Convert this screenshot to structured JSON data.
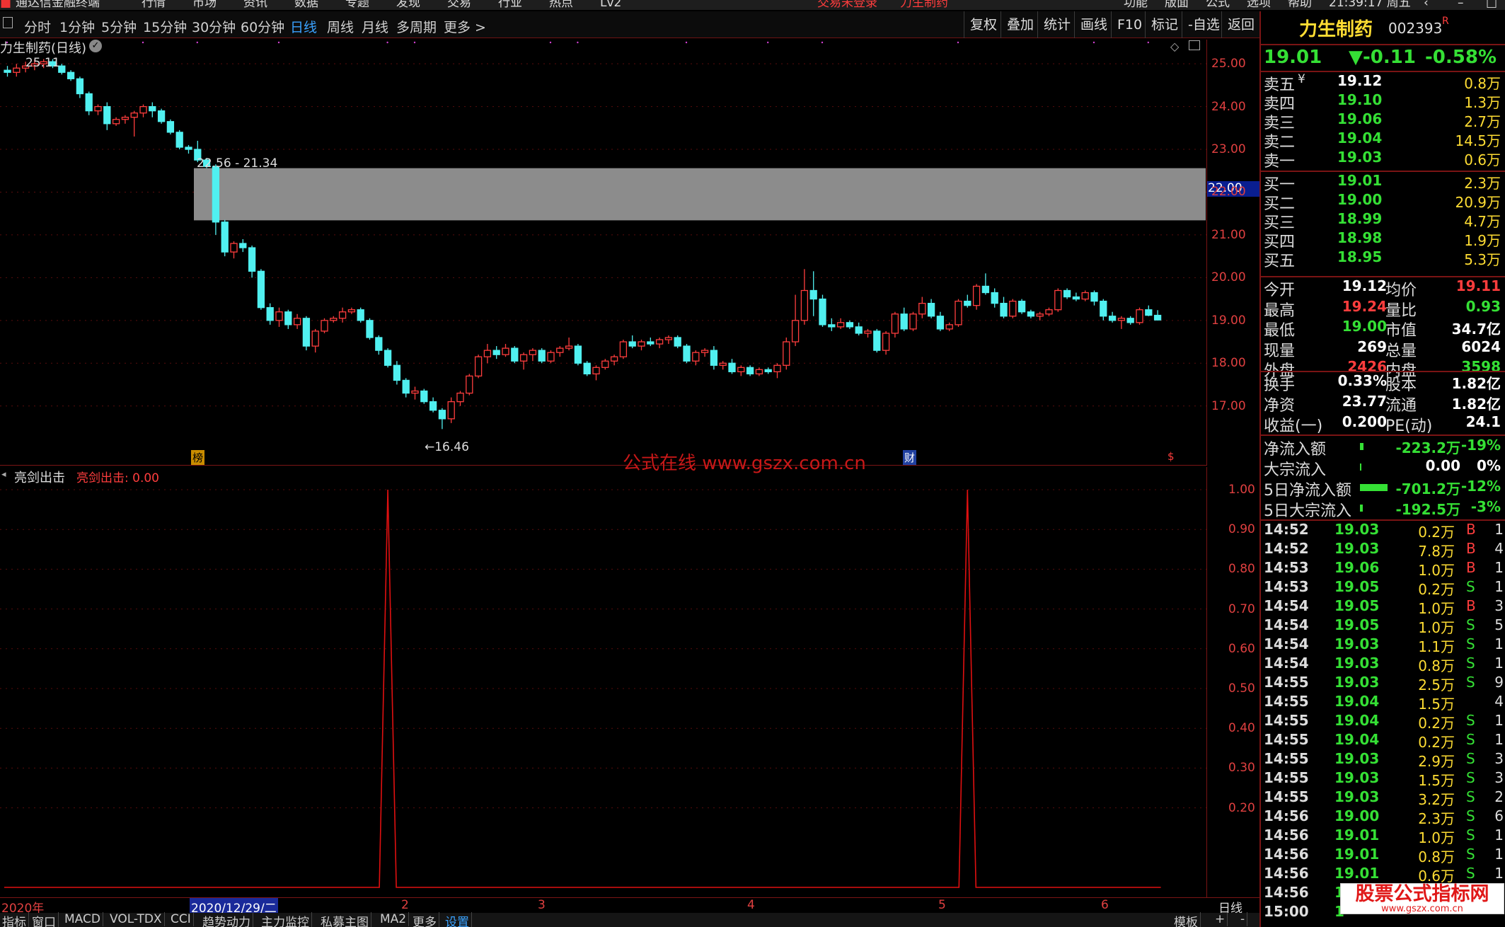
{
  "menubar": {
    "items": [
      "通达信金融终端",
      "行情",
      "市场",
      "资讯",
      "数据",
      "专题",
      "发现",
      "交易",
      "行业",
      "热点",
      "Lv2",
      "交易未登录",
      "力生制药",
      "功能",
      "版面",
      "公式",
      "选项",
      "帮助",
      "21:39:17 周五"
    ]
  },
  "toolbar": {
    "periods": [
      "分时",
      "1分钟",
      "5分钟",
      "15分钟",
      "30分钟",
      "60分钟",
      "日线",
      "周线",
      "月线",
      "多周期",
      "更多 >"
    ],
    "active_period": "日线",
    "right_buttons": [
      "复权",
      "叠加",
      "统计",
      "画线",
      "F10",
      "标记",
      "-自选",
      "返回"
    ]
  },
  "main_chart": {
    "title": "力生制药(日线)",
    "y_ticks": [
      "25.00",
      "24.00",
      "23.00",
      "22.00",
      "21.00",
      "20.00",
      "19.00",
      "18.00",
      "17.00"
    ],
    "price_marker": "22.00",
    "high_label": "25.11",
    "low_label": "←16.46",
    "range_label": "22.56 - 21.34",
    "box_top": 22.56,
    "box_bottom": 21.34,
    "event_markers": [
      "榜",
      "财",
      "$"
    ],
    "watermark": "公式在线  www.gszx.com.cn"
  },
  "sub_chart": {
    "title": "亮剑出击",
    "value_label": "亮剑出击: 0.00",
    "y_ticks": [
      "1.00",
      "0.90",
      "0.80",
      "0.70",
      "0.60",
      "0.50",
      "0.40",
      "0.30",
      "0.20"
    ],
    "signal_candle_indices": [
      42,
      106
    ]
  },
  "date_axis": {
    "labels": [
      "2020年",
      "2020/12/29/二",
      "2",
      "3",
      "4",
      "5",
      "6"
    ],
    "period_label": "日线"
  },
  "bottom_tabs": [
    "指标",
    "窗口",
    "MACD",
    "VOL-TDX",
    "CCI",
    "趋势动力",
    "主力监控",
    "私募主图",
    "MA2",
    "更多",
    "设置",
    "模板",
    "+",
    "-"
  ],
  "chart_data": {
    "type": "candlestick",
    "ylim": [
      16.3,
      25.4
    ],
    "candles": [
      [
        24.85,
        24.95,
        24.7,
        24.8
      ],
      [
        24.8,
        25.0,
        24.7,
        24.9
      ],
      [
        24.9,
        25.05,
        24.8,
        24.95
      ],
      [
        24.95,
        25.1,
        24.85,
        25.0
      ],
      [
        25.0,
        25.11,
        24.9,
        25.05
      ],
      [
        25.05,
        25.11,
        24.9,
        24.95
      ],
      [
        24.95,
        25.0,
        24.75,
        24.8
      ],
      [
        24.8,
        24.85,
        24.6,
        24.65
      ],
      [
        24.65,
        24.7,
        24.2,
        24.3
      ],
      [
        24.3,
        24.35,
        23.8,
        23.9
      ],
      [
        23.9,
        24.05,
        23.8,
        24.0
      ],
      [
        24.0,
        24.1,
        23.45,
        23.6
      ],
      [
        23.6,
        23.75,
        23.55,
        23.7
      ],
      [
        23.7,
        23.8,
        23.6,
        23.75
      ],
      [
        23.75,
        23.9,
        23.3,
        23.85
      ],
      [
        23.85,
        24.05,
        23.75,
        24.0
      ],
      [
        24.0,
        24.1,
        23.75,
        23.9
      ],
      [
        23.9,
        23.95,
        23.6,
        23.65
      ],
      [
        23.65,
        23.7,
        23.35,
        23.4
      ],
      [
        23.4,
        23.45,
        23.0,
        23.05
      ],
      [
        23.05,
        23.1,
        22.9,
        23.0
      ],
      [
        23.0,
        23.2,
        22.7,
        22.75
      ],
      [
        22.75,
        22.8,
        22.56,
        22.6
      ],
      [
        22.6,
        22.65,
        21.0,
        21.3
      ],
      [
        21.3,
        21.35,
        20.5,
        20.6
      ],
      [
        20.6,
        20.85,
        20.45,
        20.8
      ],
      [
        20.8,
        20.9,
        20.6,
        20.7
      ],
      [
        20.7,
        20.75,
        20.0,
        20.15
      ],
      [
        20.15,
        20.2,
        19.25,
        19.3
      ],
      [
        19.3,
        19.4,
        18.9,
        19.0
      ],
      [
        19.0,
        19.3,
        18.85,
        19.2
      ],
      [
        19.2,
        19.25,
        18.8,
        18.9
      ],
      [
        18.9,
        19.15,
        18.8,
        19.05
      ],
      [
        19.05,
        19.1,
        18.3,
        18.4
      ],
      [
        18.4,
        18.8,
        18.25,
        18.75
      ],
      [
        18.75,
        19.05,
        18.7,
        19.0
      ],
      [
        19.0,
        19.1,
        18.95,
        19.05
      ],
      [
        19.05,
        19.3,
        18.95,
        19.2
      ],
      [
        19.2,
        19.3,
        19.15,
        19.25
      ],
      [
        19.25,
        19.3,
        18.95,
        19.0
      ],
      [
        19.0,
        19.05,
        18.55,
        18.6
      ],
      [
        18.6,
        18.65,
        18.2,
        18.3
      ],
      [
        18.3,
        18.35,
        17.9,
        17.95
      ],
      [
        17.95,
        18.05,
        17.5,
        17.6
      ],
      [
        17.6,
        17.65,
        17.2,
        17.3
      ],
      [
        17.3,
        17.45,
        17.15,
        17.35
      ],
      [
        17.35,
        17.4,
        17.05,
        17.1
      ],
      [
        17.1,
        17.2,
        16.85,
        16.9
      ],
      [
        16.9,
        16.95,
        16.46,
        16.7
      ],
      [
        16.7,
        17.2,
        16.6,
        17.1
      ],
      [
        17.1,
        17.35,
        17.0,
        17.3
      ],
      [
        17.3,
        17.75,
        17.25,
        17.7
      ],
      [
        17.7,
        18.2,
        17.65,
        18.15
      ],
      [
        18.15,
        18.45,
        18.0,
        18.3
      ],
      [
        18.3,
        18.4,
        18.1,
        18.2
      ],
      [
        18.2,
        18.45,
        18.15,
        18.35
      ],
      [
        18.35,
        18.4,
        18.0,
        18.05
      ],
      [
        18.05,
        18.25,
        17.85,
        18.2
      ],
      [
        18.2,
        18.35,
        18.05,
        18.3
      ],
      [
        18.3,
        18.35,
        18.0,
        18.05
      ],
      [
        18.05,
        18.3,
        18.0,
        18.25
      ],
      [
        18.25,
        18.4,
        18.15,
        18.35
      ],
      [
        18.35,
        18.6,
        18.3,
        18.4
      ],
      [
        18.4,
        18.45,
        17.95,
        18.0
      ],
      [
        18.0,
        18.05,
        17.7,
        17.75
      ],
      [
        17.75,
        17.95,
        17.6,
        17.9
      ],
      [
        17.9,
        18.1,
        17.85,
        18.05
      ],
      [
        18.05,
        18.2,
        17.95,
        18.15
      ],
      [
        18.15,
        18.55,
        18.1,
        18.5
      ],
      [
        18.5,
        18.65,
        18.35,
        18.4
      ],
      [
        18.4,
        18.55,
        18.3,
        18.5
      ],
      [
        18.5,
        18.6,
        18.4,
        18.45
      ],
      [
        18.45,
        18.6,
        18.35,
        18.55
      ],
      [
        18.55,
        18.65,
        18.45,
        18.6
      ],
      [
        18.6,
        18.65,
        18.35,
        18.4
      ],
      [
        18.4,
        18.45,
        18.0,
        18.05
      ],
      [
        18.05,
        18.3,
        17.95,
        18.25
      ],
      [
        18.25,
        18.35,
        18.15,
        18.3
      ],
      [
        18.3,
        18.4,
        17.85,
        17.95
      ],
      [
        17.95,
        18.05,
        17.85,
        18.0
      ],
      [
        18.0,
        18.1,
        17.75,
        17.8
      ],
      [
        17.8,
        17.95,
        17.7,
        17.9
      ],
      [
        17.9,
        17.95,
        17.7,
        17.75
      ],
      [
        17.75,
        17.9,
        17.7,
        17.85
      ],
      [
        17.85,
        17.9,
        17.75,
        17.8
      ],
      [
        17.8,
        18.0,
        17.65,
        17.95
      ],
      [
        17.95,
        18.6,
        17.85,
        18.5
      ],
      [
        18.5,
        19.6,
        18.4,
        19.0
      ],
      [
        19.0,
        20.2,
        18.9,
        19.7
      ],
      [
        19.7,
        20.15,
        19.1,
        19.5
      ],
      [
        19.5,
        19.6,
        18.85,
        18.9
      ],
      [
        18.9,
        19.05,
        18.75,
        18.85
      ],
      [
        18.85,
        19.05,
        18.8,
        18.95
      ],
      [
        18.95,
        19.0,
        18.8,
        18.85
      ],
      [
        18.85,
        18.95,
        18.65,
        18.7
      ],
      [
        18.7,
        18.8,
        18.6,
        18.75
      ],
      [
        18.75,
        18.8,
        18.25,
        18.3
      ],
      [
        18.3,
        18.75,
        18.2,
        18.7
      ],
      [
        18.7,
        19.2,
        18.6,
        19.15
      ],
      [
        19.15,
        19.3,
        18.75,
        18.8
      ],
      [
        18.8,
        19.2,
        18.75,
        19.15
      ],
      [
        19.15,
        19.55,
        19.05,
        19.4
      ],
      [
        19.4,
        19.5,
        19.05,
        19.1
      ],
      [
        19.1,
        19.2,
        18.75,
        18.8
      ],
      [
        18.8,
        18.95,
        18.75,
        18.9
      ],
      [
        18.9,
        19.5,
        18.85,
        19.45
      ],
      [
        19.45,
        19.6,
        19.3,
        19.35
      ],
      [
        19.35,
        19.85,
        19.25,
        19.8
      ],
      [
        19.8,
        20.1,
        19.6,
        19.65
      ],
      [
        19.65,
        19.75,
        19.3,
        19.4
      ],
      [
        19.4,
        19.55,
        19.05,
        19.1
      ],
      [
        19.1,
        19.5,
        19.05,
        19.45
      ],
      [
        19.45,
        19.5,
        19.15,
        19.2
      ],
      [
        19.2,
        19.25,
        19.05,
        19.1
      ],
      [
        19.1,
        19.2,
        19.0,
        19.15
      ],
      [
        19.15,
        19.3,
        19.1,
        19.25
      ],
      [
        19.25,
        19.75,
        19.2,
        19.7
      ],
      [
        19.7,
        19.75,
        19.5,
        19.55
      ],
      [
        19.55,
        19.65,
        19.45,
        19.5
      ],
      [
        19.5,
        19.7,
        19.45,
        19.65
      ],
      [
        19.65,
        19.7,
        19.35,
        19.45
      ],
      [
        19.45,
        19.5,
        19.0,
        19.1
      ],
      [
        19.1,
        19.2,
        18.95,
        19.0
      ],
      [
        19.0,
        19.1,
        18.8,
        19.05
      ],
      [
        19.05,
        19.1,
        18.9,
        18.95
      ],
      [
        18.95,
        19.3,
        18.9,
        19.25
      ],
      [
        19.25,
        19.35,
        19.1,
        19.12
      ],
      [
        19.12,
        19.24,
        19.0,
        19.01
      ]
    ]
  },
  "quote_panel": {
    "stock_name": "力生制药",
    "stock_code": "002393",
    "stock_tag": "R",
    "price": "19.01",
    "change": "▼-0.11",
    "change_pct": "-0.58%",
    "asks": [
      {
        "label": "卖五",
        "sym": "¥",
        "price": "19.12",
        "vol": "0.8万"
      },
      {
        "label": "卖四",
        "sym": "",
        "price": "19.10",
        "vol": "1.3万"
      },
      {
        "label": "卖三",
        "sym": "",
        "price": "19.06",
        "vol": "2.7万"
      },
      {
        "label": "卖二",
        "sym": "",
        "price": "19.04",
        "vol": "14.5万"
      },
      {
        "label": "卖一",
        "sym": "",
        "price": "19.03",
        "vol": "0.6万"
      }
    ],
    "bids": [
      {
        "label": "买一",
        "price": "19.01",
        "vol": "2.3万"
      },
      {
        "label": "买二",
        "price": "19.00",
        "vol": "20.9万"
      },
      {
        "label": "买三",
        "price": "18.99",
        "vol": "4.7万"
      },
      {
        "label": "买四",
        "price": "18.98",
        "vol": "1.9万"
      },
      {
        "label": "买五",
        "price": "18.95",
        "vol": "5.3万"
      }
    ],
    "stats": [
      {
        "l1": "今开",
        "v1": "19.12",
        "c1": "white",
        "l2": "均价",
        "v2": "19.11",
        "c2": "red"
      },
      {
        "l1": "最高",
        "v1": "19.24",
        "c1": "red",
        "l2": "量比",
        "v2": "0.93",
        "c2": "green"
      },
      {
        "l1": "最低",
        "v1": "19.00",
        "c1": "green",
        "l2": "市值",
        "v2": "34.7亿",
        "c2": "white"
      },
      {
        "l1": "现量",
        "v1": "269",
        "c1": "white",
        "l2": "总量",
        "v2": "6024",
        "c2": "white"
      },
      {
        "l1": "外盘",
        "v1": "2426",
        "c1": "red",
        "l2": "内盘",
        "v2": "3598",
        "c2": "green"
      }
    ],
    "fundamentals": [
      {
        "l1": "换手",
        "v1": "0.33%",
        "l2": "股本",
        "v2": "1.82亿"
      },
      {
        "l1": "净资",
        "v1": "23.77",
        "l2": "流通",
        "v2": "1.82亿"
      },
      {
        "l1": "收益(一)",
        "v1": "0.200",
        "l2": "PE(动)",
        "v2": "24.1"
      }
    ],
    "flows": [
      {
        "label": "净流入额",
        "value": "-223.2万",
        "pct": "-19%",
        "bar": 0.04
      },
      {
        "label": "大宗流入",
        "value": "0.00",
        "pct": "0%",
        "bar": 0
      },
      {
        "label": "5日净流入额",
        "value": "-701.2万",
        "pct": "-12%",
        "bar": 0.3
      },
      {
        "label": "5日大宗流入",
        "value": "-192.5万",
        "pct": "-3%",
        "bar": 0.03
      }
    ],
    "ticks": [
      {
        "t": "14:52",
        "p": "19.03",
        "v": "0.2万",
        "d": "B",
        "n": "1"
      },
      {
        "t": "14:52",
        "p": "19.03",
        "v": "7.8万",
        "d": "B",
        "n": "4"
      },
      {
        "t": "14:53",
        "p": "19.06",
        "v": "1.0万",
        "d": "B",
        "n": "1"
      },
      {
        "t": "14:53",
        "p": "19.05",
        "v": "0.2万",
        "d": "S",
        "n": "1"
      },
      {
        "t": "14:54",
        "p": "19.05",
        "v": "1.0万",
        "d": "B",
        "n": "3"
      },
      {
        "t": "14:54",
        "p": "19.05",
        "v": "1.0万",
        "d": "S",
        "n": "5"
      },
      {
        "t": "14:54",
        "p": "19.03",
        "v": "1.1万",
        "d": "S",
        "n": "1"
      },
      {
        "t": "14:54",
        "p": "19.03",
        "v": "0.8万",
        "d": "S",
        "n": "1"
      },
      {
        "t": "14:55",
        "p": "19.03",
        "v": "2.5万",
        "d": "S",
        "n": "9"
      },
      {
        "t": "14:55",
        "p": "19.04",
        "v": "1.5万",
        "d": "",
        "n": "4"
      },
      {
        "t": "14:55",
        "p": "19.04",
        "v": "0.2万",
        "d": "S",
        "n": "1"
      },
      {
        "t": "14:55",
        "p": "19.04",
        "v": "0.2万",
        "d": "S",
        "n": "1"
      },
      {
        "t": "14:55",
        "p": "19.03",
        "v": "2.9万",
        "d": "S",
        "n": "3"
      },
      {
        "t": "14:55",
        "p": "19.03",
        "v": "1.5万",
        "d": "S",
        "n": "3"
      },
      {
        "t": "14:55",
        "p": "19.03",
        "v": "3.2万",
        "d": "S",
        "n": "2"
      },
      {
        "t": "14:56",
        "p": "19.00",
        "v": "2.3万",
        "d": "S",
        "n": "6"
      },
      {
        "t": "14:56",
        "p": "19.01",
        "v": "1.0万",
        "d": "S",
        "n": "1"
      },
      {
        "t": "14:56",
        "p": "19.01",
        "v": "0.8万",
        "d": "S",
        "n": "1"
      },
      {
        "t": "14:56",
        "p": "19.01",
        "v": "0.6万",
        "d": "S",
        "n": "1"
      },
      {
        "t": "14:56",
        "p": "1",
        "v": "",
        "d": "",
        "n": ""
      },
      {
        "t": "15:00",
        "p": "1",
        "v": "",
        "d": "",
        "n": ""
      }
    ],
    "bottom_watermark": "股票公式指标网",
    "bottom_watermark_url": "www.gszx.com.cn"
  },
  "colors": {
    "up": "#ff3d3d",
    "down": "#50f0f0",
    "box": "#8c8c8c",
    "signal": "#e01010",
    "accent": "#7a1414"
  }
}
